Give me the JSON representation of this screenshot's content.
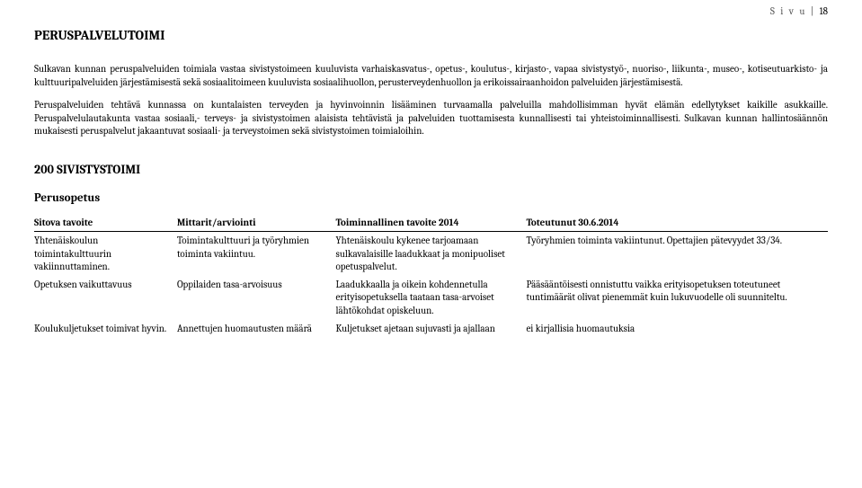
{
  "page": {
    "label": "S i v u",
    "number": "18"
  },
  "heading_main": "PERUSPALVELUTOIMI",
  "para1": "Sulkavan kunnan peruspalveluiden toimiala vastaa sivistystoimeen kuuluvista varhaiskasvatus-, opetus-, koulutus-, kirjasto-, vapaa sivistystyö-, nuoriso-, liikunta-, museo-, kotiseutuarkisto- ja kulttuuripalveluiden järjestämisestä sekä sosiaalitoimeen kuuluvista sosiaalihuollon, perusterveydenhuollon ja erikoissairaanhoidon palveluiden järjestämisestä.",
  "para2": "Peruspalveluiden tehtävä kunnassa on kuntalaisten terveyden ja hyvinvoinnin lisääminen turvaamalla palveluilla mahdollisimman hyvät elämän edellytykset kaikille asukkaille. Peruspalvelulautakunta vastaa sosiaali,- terveys- ja sivistystoimen alaisista tehtävistä ja palveluiden tuottamisesta kunnallisesti tai yhteistoiminnallisesti. Sulkavan kunnan hallintosäännön mukaisesti peruspalvelut jakaantuvat sosiaali- ja terveystoimen sekä sivistystoimen toimialoihin.",
  "heading_200": "200 SIVISTYSTOIMI",
  "heading_perusopetus": "Perusopetus",
  "table": {
    "headers": {
      "c1": "Sitova tavoite",
      "c2": "Mittarit/arviointi",
      "c3": "Toiminnallinen tavoite 2014",
      "c4": "Toteutunut 30.6.2014"
    },
    "rows": [
      {
        "c1": "Yhtenäiskoulun toimintakulttuurin vakiinnuttaminen.",
        "c2": "Toimintakulttuuri ja työryhmien toiminta vakiintuu.",
        "c3": "Yhtenäiskoulu kykenee tarjoamaan sulkavalaisille laadukkaat ja monipuoliset opetuspalvelut.",
        "c4": "Työryhmien toiminta vakiintunut. Opettajien pätevyydet 33/34."
      },
      {
        "c1": "Opetuksen vaikuttavuus",
        "c2": "Oppilaiden tasa-arvoisuus",
        "c3": "Laadukkaalla ja oikein kohdennetulla erityisopetuksella taataan tasa-arvoiset lähtökohdat opiskeluun.",
        "c4": "Pääsääntöisesti onnistuttu vaikka erityisopetuksen toteutuneet tuntimäärät olivat pienemmät kuin lukuvuodelle oli suunniteltu."
      },
      {
        "c1": "Koulukuljetukset toimivat hyvin.",
        "c2": "Annettujen huomautusten määrä",
        "c3": "Kuljetukset ajetaan sujuvasti ja ajallaan",
        "c4": "ei kirjallisia huomautuksia"
      }
    ]
  }
}
